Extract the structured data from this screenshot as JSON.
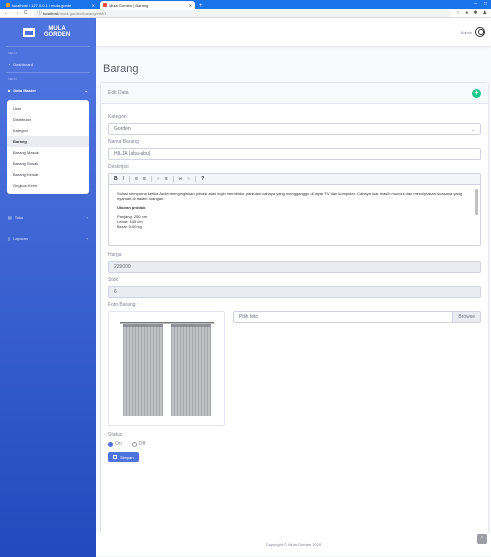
{
  "browser": {
    "tabs": [
      {
        "title": "localhost / 127.0.0.1 / mula-gorde"
      },
      {
        "title": "Mula Gorden | Barang"
      }
    ],
    "url_host": "localhost",
    "url_path": "/mula-gorden/barang/edit/1"
  },
  "colors": {
    "primary": "#4e73df",
    "success": "#1cc88a",
    "tab_bar": "#1a73e8"
  },
  "sidebar": {
    "brand": "MULA GORDEN",
    "headings": [
      "MENU",
      "MENU"
    ],
    "dashboard": "Dashboard",
    "data_master": "Data Master",
    "sub_items": [
      "User",
      "Distributor",
      "Kategori",
      "Barang",
      "Barang Masuk",
      "Barang Rusak",
      "Barang Keluar",
      "Ongkos Kirim"
    ],
    "active_sub": "Barang",
    "toko": "Toko",
    "laporan": "Laporan"
  },
  "topbar": {
    "user": "Admin"
  },
  "page": {
    "title": "Barang"
  },
  "card": {
    "title": "Edit Data"
  },
  "form": {
    "kategori_label": "Kategori",
    "kategori_value": "Gorden",
    "nama_label": "Nama Barang",
    "nama_value": "HILJA (abu-abu)",
    "deskripsi_label": "Deskripsi",
    "toolbar": [
      "B",
      "I",
      "≡",
      "≡",
      "≡",
      "≡",
      "∞",
      "≡",
      "?"
    ],
    "description_para": "Solusi sempurna ketika Anda menginginkan privasi atau ingin membidor pantulan cahaya yang mengganggu di layar TV dan komputer. Cahaya luar masih muncul dan menciptakan suasana yang nyaman di dalam ruangan.",
    "ukuran_heading": "Ukuran produk",
    "ukuran_lines": [
      "Panjang: 250 cm",
      "Lebar: 145 cm",
      "Berat: 0.60 kg"
    ],
    "harga_label": "Harga",
    "harga_value": "229000",
    "stok_label": "Stok",
    "stok_value": "6",
    "foto_label": "Foto Barang :",
    "file_placeholder": "Pilih foto",
    "browse_label": "Browse",
    "status_label": "Status",
    "status_on": "On",
    "status_off": "Off",
    "save_label": "Simpan"
  },
  "footer": {
    "text": "Copyright © Mula Gorden 2020"
  }
}
